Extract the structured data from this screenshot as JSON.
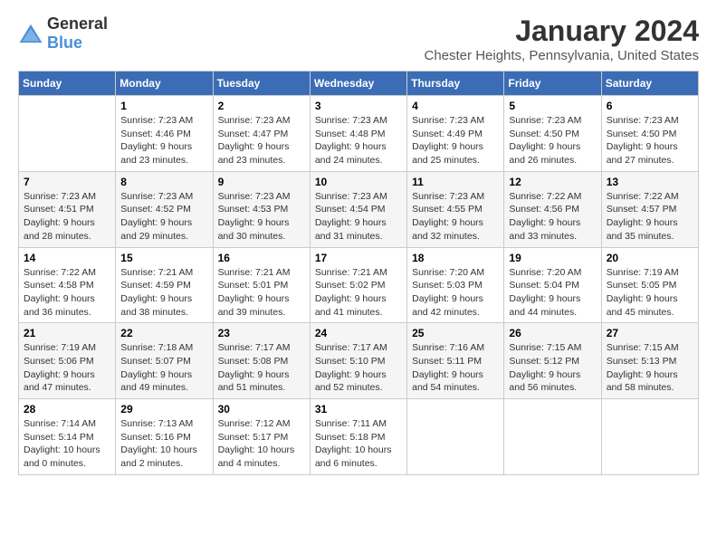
{
  "logo": {
    "general": "General",
    "blue": "Blue"
  },
  "header": {
    "month": "January 2024",
    "location": "Chester Heights, Pennsylvania, United States"
  },
  "weekdays": [
    "Sunday",
    "Monday",
    "Tuesday",
    "Wednesday",
    "Thursday",
    "Friday",
    "Saturday"
  ],
  "weeks": [
    [
      {
        "day": "",
        "info": ""
      },
      {
        "day": "1",
        "info": "Sunrise: 7:23 AM\nSunset: 4:46 PM\nDaylight: 9 hours\nand 23 minutes."
      },
      {
        "day": "2",
        "info": "Sunrise: 7:23 AM\nSunset: 4:47 PM\nDaylight: 9 hours\nand 23 minutes."
      },
      {
        "day": "3",
        "info": "Sunrise: 7:23 AM\nSunset: 4:48 PM\nDaylight: 9 hours\nand 24 minutes."
      },
      {
        "day": "4",
        "info": "Sunrise: 7:23 AM\nSunset: 4:49 PM\nDaylight: 9 hours\nand 25 minutes."
      },
      {
        "day": "5",
        "info": "Sunrise: 7:23 AM\nSunset: 4:50 PM\nDaylight: 9 hours\nand 26 minutes."
      },
      {
        "day": "6",
        "info": "Sunrise: 7:23 AM\nSunset: 4:50 PM\nDaylight: 9 hours\nand 27 minutes."
      }
    ],
    [
      {
        "day": "7",
        "info": "Sunrise: 7:23 AM\nSunset: 4:51 PM\nDaylight: 9 hours\nand 28 minutes."
      },
      {
        "day": "8",
        "info": "Sunrise: 7:23 AM\nSunset: 4:52 PM\nDaylight: 9 hours\nand 29 minutes."
      },
      {
        "day": "9",
        "info": "Sunrise: 7:23 AM\nSunset: 4:53 PM\nDaylight: 9 hours\nand 30 minutes."
      },
      {
        "day": "10",
        "info": "Sunrise: 7:23 AM\nSunset: 4:54 PM\nDaylight: 9 hours\nand 31 minutes."
      },
      {
        "day": "11",
        "info": "Sunrise: 7:23 AM\nSunset: 4:55 PM\nDaylight: 9 hours\nand 32 minutes."
      },
      {
        "day": "12",
        "info": "Sunrise: 7:22 AM\nSunset: 4:56 PM\nDaylight: 9 hours\nand 33 minutes."
      },
      {
        "day": "13",
        "info": "Sunrise: 7:22 AM\nSunset: 4:57 PM\nDaylight: 9 hours\nand 35 minutes."
      }
    ],
    [
      {
        "day": "14",
        "info": "Sunrise: 7:22 AM\nSunset: 4:58 PM\nDaylight: 9 hours\nand 36 minutes."
      },
      {
        "day": "15",
        "info": "Sunrise: 7:21 AM\nSunset: 4:59 PM\nDaylight: 9 hours\nand 38 minutes."
      },
      {
        "day": "16",
        "info": "Sunrise: 7:21 AM\nSunset: 5:01 PM\nDaylight: 9 hours\nand 39 minutes."
      },
      {
        "day": "17",
        "info": "Sunrise: 7:21 AM\nSunset: 5:02 PM\nDaylight: 9 hours\nand 41 minutes."
      },
      {
        "day": "18",
        "info": "Sunrise: 7:20 AM\nSunset: 5:03 PM\nDaylight: 9 hours\nand 42 minutes."
      },
      {
        "day": "19",
        "info": "Sunrise: 7:20 AM\nSunset: 5:04 PM\nDaylight: 9 hours\nand 44 minutes."
      },
      {
        "day": "20",
        "info": "Sunrise: 7:19 AM\nSunset: 5:05 PM\nDaylight: 9 hours\nand 45 minutes."
      }
    ],
    [
      {
        "day": "21",
        "info": "Sunrise: 7:19 AM\nSunset: 5:06 PM\nDaylight: 9 hours\nand 47 minutes."
      },
      {
        "day": "22",
        "info": "Sunrise: 7:18 AM\nSunset: 5:07 PM\nDaylight: 9 hours\nand 49 minutes."
      },
      {
        "day": "23",
        "info": "Sunrise: 7:17 AM\nSunset: 5:08 PM\nDaylight: 9 hours\nand 51 minutes."
      },
      {
        "day": "24",
        "info": "Sunrise: 7:17 AM\nSunset: 5:10 PM\nDaylight: 9 hours\nand 52 minutes."
      },
      {
        "day": "25",
        "info": "Sunrise: 7:16 AM\nSunset: 5:11 PM\nDaylight: 9 hours\nand 54 minutes."
      },
      {
        "day": "26",
        "info": "Sunrise: 7:15 AM\nSunset: 5:12 PM\nDaylight: 9 hours\nand 56 minutes."
      },
      {
        "day": "27",
        "info": "Sunrise: 7:15 AM\nSunset: 5:13 PM\nDaylight: 9 hours\nand 58 minutes."
      }
    ],
    [
      {
        "day": "28",
        "info": "Sunrise: 7:14 AM\nSunset: 5:14 PM\nDaylight: 10 hours\nand 0 minutes."
      },
      {
        "day": "29",
        "info": "Sunrise: 7:13 AM\nSunset: 5:16 PM\nDaylight: 10 hours\nand 2 minutes."
      },
      {
        "day": "30",
        "info": "Sunrise: 7:12 AM\nSunset: 5:17 PM\nDaylight: 10 hours\nand 4 minutes."
      },
      {
        "day": "31",
        "info": "Sunrise: 7:11 AM\nSunset: 5:18 PM\nDaylight: 10 hours\nand 6 minutes."
      },
      {
        "day": "",
        "info": ""
      },
      {
        "day": "",
        "info": ""
      },
      {
        "day": "",
        "info": ""
      }
    ]
  ]
}
